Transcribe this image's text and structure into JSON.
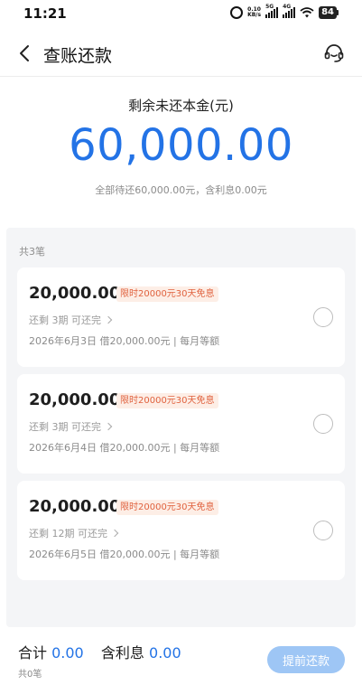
{
  "status_bar": {
    "time": "11:21",
    "network_speed": "0.10",
    "network_unit": "KB/s",
    "signal_1": "5G",
    "signal_2": "4G",
    "battery": "84"
  },
  "nav": {
    "title": "查账还款",
    "back_icon": "chevron-left-icon",
    "service_icon": "customer-service-icon"
  },
  "summary": {
    "label": "剩余未还本金(元)",
    "amount": "60,000.00",
    "note": "全部待还60,000.00元，含利息0.00元"
  },
  "list": {
    "count_text": "共3笔",
    "loans": [
      {
        "amount": "20,000.00",
        "badge": "限时20000元30天免息",
        "remaining": "还剩 3期 可还完",
        "detail": "2026年6月3日 借20,000.00元 | 每月等额"
      },
      {
        "amount": "20,000.00",
        "badge": "限时20000元30天免息",
        "remaining": "还剩 3期 可还完",
        "detail": "2026年6月4日 借20,000.00元 | 每月等额"
      },
      {
        "amount": "20,000.00",
        "badge": "限时20000元30天免息",
        "remaining": "还剩 12期 可还完",
        "detail": "2026年6月5日 借20,000.00元 | 每月等额"
      }
    ]
  },
  "footer": {
    "total_label": "合计",
    "total_value": "0.00",
    "interest_label": "含利息",
    "interest_value": "0.00",
    "selected_count": "共0笔",
    "prepay_button": "提前还款"
  },
  "colors": {
    "accent": "#2373e6",
    "badge_text": "#e0623e",
    "badge_bg": "#fdeee6",
    "button_disabled": "#9ec6f5",
    "list_bg": "#f4f5f7"
  }
}
